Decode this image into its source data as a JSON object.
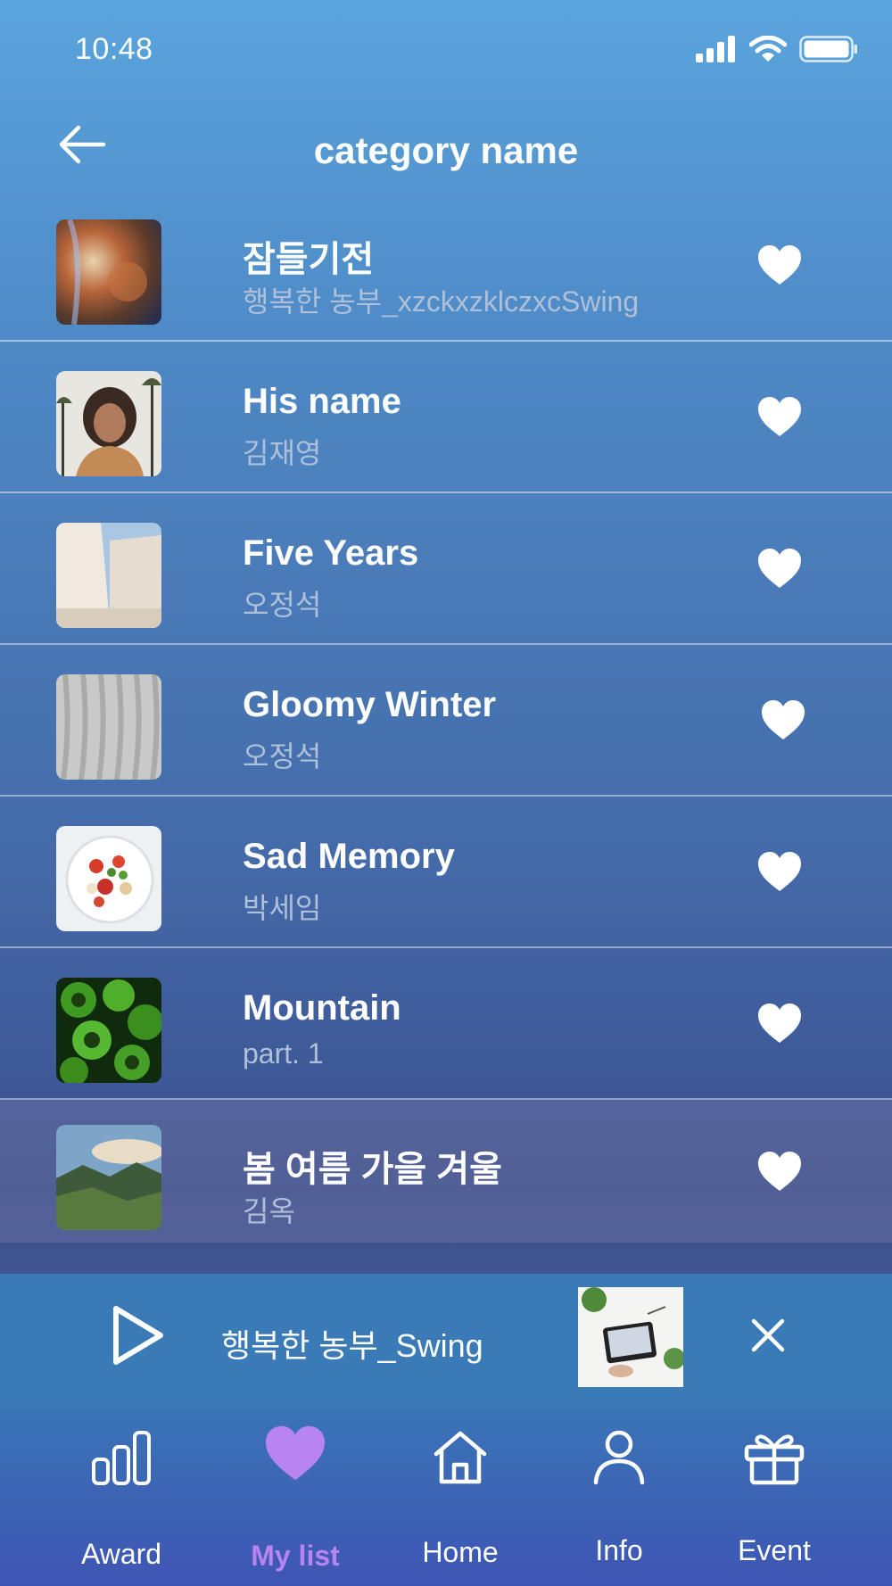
{
  "status": {
    "time": "10:48"
  },
  "header": {
    "title": "category name"
  },
  "list": [
    {
      "title": "잠들기전",
      "subtitle": "행복한 농부_xzckxzklczxcSwing"
    },
    {
      "title": "His name",
      "subtitle": "김재영"
    },
    {
      "title": "Five Years",
      "subtitle": "오정석"
    },
    {
      "title": "Gloomy Winter",
      "subtitle": "오정석"
    },
    {
      "title": "Sad Memory",
      "subtitle": "박세임"
    },
    {
      "title": "Mountain",
      "subtitle": "part. 1"
    },
    {
      "title": "봄 여름 가을 겨울",
      "subtitle": "김옥"
    }
  ],
  "player": {
    "title": "행복한 농부_Swing"
  },
  "tabs": [
    {
      "label": "Award",
      "icon": "bar-chart-icon"
    },
    {
      "label": "My list",
      "icon": "heart-icon",
      "active": true
    },
    {
      "label": "Home",
      "icon": "home-icon"
    },
    {
      "label": "Info",
      "icon": "user-icon"
    },
    {
      "label": "Event",
      "icon": "gift-icon"
    }
  ],
  "colors": {
    "active_tab": "#b784f0",
    "player_bg": "#3a7ab6",
    "subtitle": "#aec0da"
  }
}
